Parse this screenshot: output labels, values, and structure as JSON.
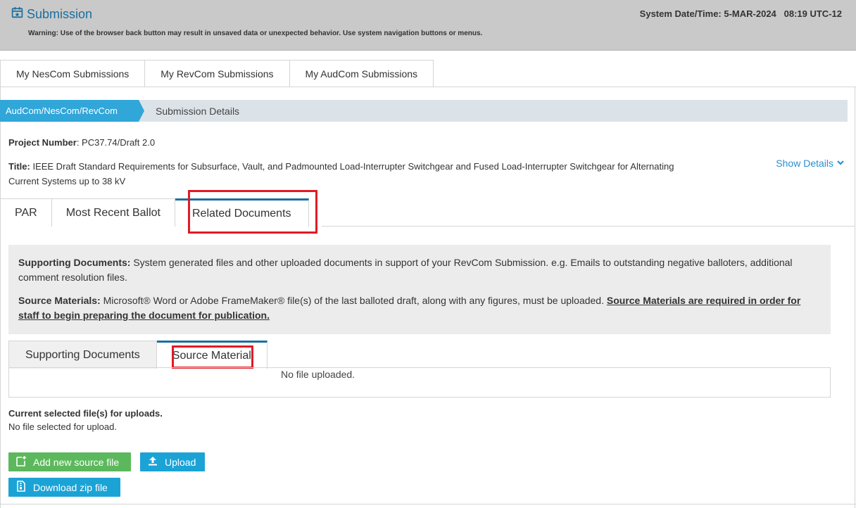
{
  "header": {
    "title": "Submission",
    "system_datetime": "System Date/Time: 5-MAR-2024   08:19 UTC-12",
    "warning": "Warning: Use of the browser back button may result in unsaved data or unexpected behavior. Use system navigation buttons or menus."
  },
  "top_tabs": [
    "My NesCom Submissions",
    "My RevCom Submissions",
    "My AudCom Submissions"
  ],
  "breadcrumb": {
    "active": "AudCom/NesCom/RevCom",
    "current": "Submission Details"
  },
  "project": {
    "number_label": "Project Number",
    "number_value": ": PC37.74/Draft 2.0",
    "title_label": "Title:",
    "title_value": " IEEE Draft Standard Requirements for Subsurface, Vault, and Padmounted Load-Interrupter Switchgear and Fused Load-Interrupter Switchgear for Alternating Current Systems up to 38 kV",
    "show_details": "Show Details"
  },
  "doc_tabs": {
    "par": "PAR",
    "ballot": "Most Recent Ballot",
    "related": "Related Documents"
  },
  "info": {
    "supporting_label": "Supporting Documents:",
    "supporting_text": " System generated files and other uploaded documents in support of your RevCom Submission. e.g. Emails to outstanding negative balloters, additional comment resolution files.",
    "source_label": "Source Materials:",
    "source_text": " Microsoft® Word or Adobe FrameMaker® file(s) of the last balloted draft, along with any figures, must be uploaded. ",
    "source_required": "Source Materials are required in order for staff to begin preparing the document for publication."
  },
  "sub_tabs": {
    "supporting": "Supporting Documents",
    "source": "Source Material"
  },
  "panel": {
    "empty": "No file uploaded."
  },
  "uploads": {
    "title": "Current selected file(s) for uploads.",
    "status": "No file selected for upload."
  },
  "buttons": {
    "add": "Add new source file",
    "upload": "Upload",
    "download": "Download zip file"
  },
  "colors": {
    "accent": "#1a6fa0",
    "breadcrumb_active": "#30a6d9",
    "highlight": "#e01b24",
    "green_button": "#5cb85c",
    "blue_button": "#1ba3d6"
  },
  "icons": [
    "calendar-icon",
    "chevron-down-icon",
    "file-add-icon",
    "upload-icon",
    "zip-file-icon"
  ]
}
